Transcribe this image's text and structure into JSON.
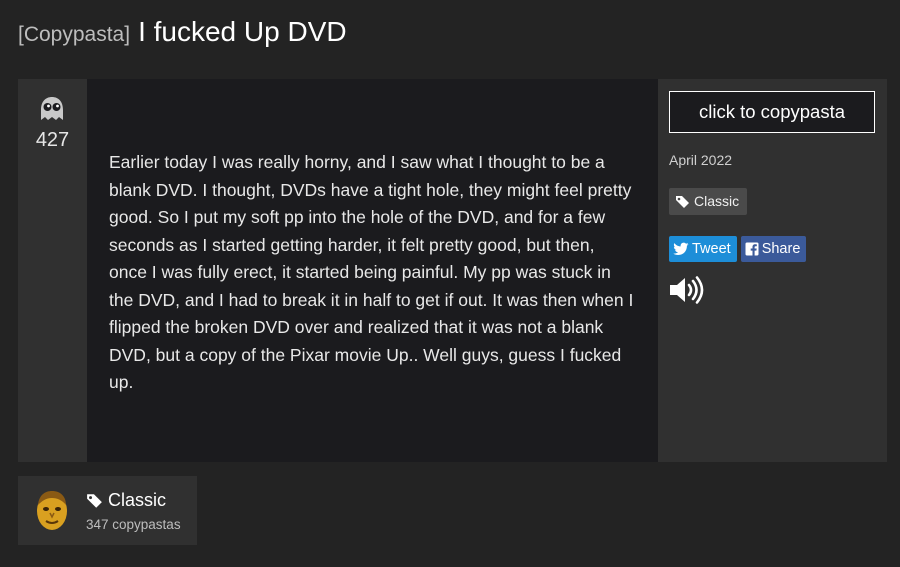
{
  "header": {
    "tag": "[Copypasta]",
    "title": "I fucked Up DVD"
  },
  "post": {
    "votes": "427",
    "body": "Earlier today I was really horny, and I saw what I thought to be a blank DVD. I thought, DVDs have a tight hole, they might feel pretty good. So I put my soft pp into the hole of the DVD, and for a few seconds as I started getting harder, it felt pretty good, but then, once I was fully erect, it started being painful. My pp was stuck in the DVD, and I had to break it in half to get if out. It was then when I flipped the broken DVD over and realized that it was not a blank DVD, but a copy of the Pixar movie Up.. Well guys, guess I fucked up.",
    "vote_icon": "ghost-icon"
  },
  "sidebar": {
    "copy_button": "click to copypasta",
    "date": "April 2022",
    "tag_label": "Classic",
    "tweet_label": "Tweet",
    "share_label": "Share",
    "speaker_icon": "speaker-icon"
  },
  "category": {
    "name": "Classic",
    "count": "347 copypastas",
    "avatar_icon": "avatar-face-icon"
  },
  "colors": {
    "background": "#232323",
    "card": "#303030",
    "text_panel": "#1b1b1e",
    "tweet": "#1d8ed8",
    "facebook": "#3b5a9a"
  }
}
